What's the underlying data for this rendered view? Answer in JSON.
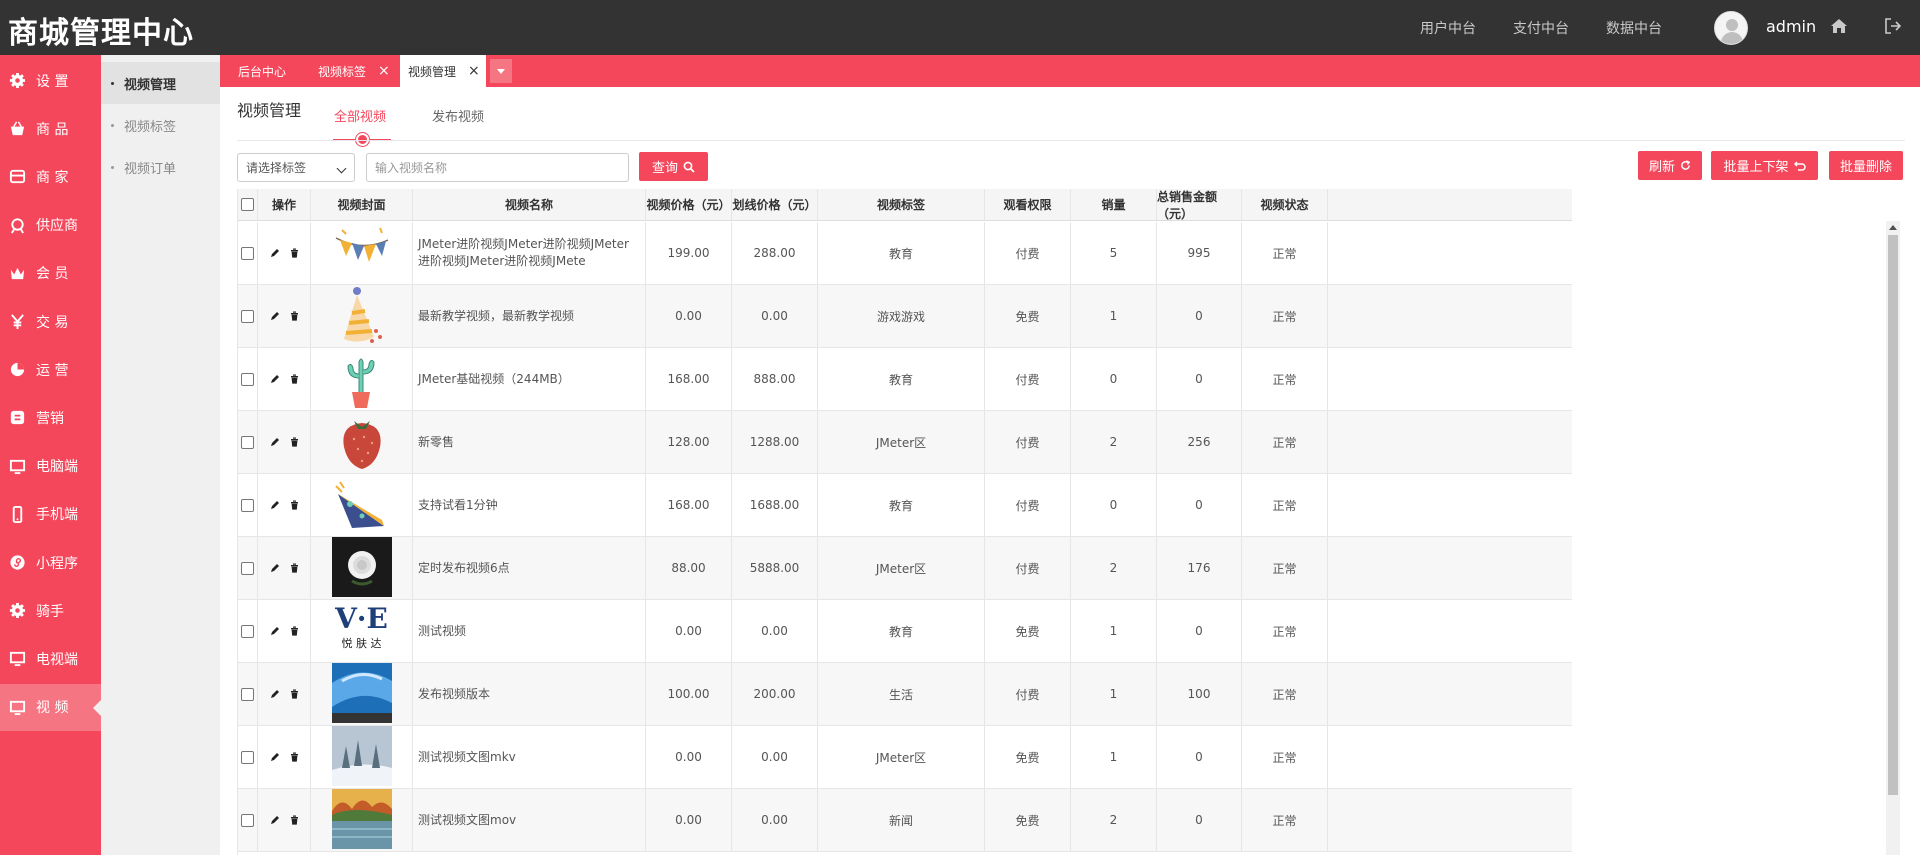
{
  "app": {
    "title": "商城管理中心",
    "user": "admin"
  },
  "topnav": [
    "用户中台",
    "支付中台",
    "数据中台"
  ],
  "sidebar": [
    {
      "label": "设 置",
      "icon": "gear-icon"
    },
    {
      "label": "商 品",
      "icon": "basket-icon"
    },
    {
      "label": "商 家",
      "icon": "store-icon"
    },
    {
      "label": "供应商",
      "icon": "supplier-icon"
    },
    {
      "label": "会 员",
      "icon": "crown-icon"
    },
    {
      "label": "交 易",
      "icon": "yen-icon"
    },
    {
      "label": "运 营",
      "icon": "pie-icon"
    },
    {
      "label": "营销",
      "icon": "marketing-icon"
    },
    {
      "label": "电脑端",
      "icon": "monitor-icon"
    },
    {
      "label": "手机端",
      "icon": "phone-icon"
    },
    {
      "label": "小程序",
      "icon": "miniapp-icon"
    },
    {
      "label": "骑手",
      "icon": "gear-icon"
    },
    {
      "label": "电视端",
      "icon": "monitor-icon"
    },
    {
      "label": "视 频",
      "icon": "monitor-icon",
      "active": true
    }
  ],
  "subnav": [
    {
      "label": "视频管理",
      "active": true
    },
    {
      "label": "视频标签"
    },
    {
      "label": "视频订单"
    }
  ],
  "tabs": [
    {
      "label": "后台中心",
      "closable": false
    },
    {
      "label": "视频标签",
      "closable": true,
      "close": "×"
    },
    {
      "label": "视频管理",
      "closable": true,
      "close": "×",
      "active": true
    }
  ],
  "page": {
    "title": "视频管理",
    "subtabs": [
      {
        "label": "全部视频",
        "active": true
      },
      {
        "label": "发布视频"
      }
    ]
  },
  "filters": {
    "tag_select": "请选择标签",
    "search_placeholder": "输入视频名称",
    "query_label": "查询"
  },
  "actions": {
    "refresh": "刷新",
    "batch_shelf": "批量上下架",
    "batch_delete": "批量删除"
  },
  "table": {
    "headers": [
      "操作",
      "视频封面",
      "视频名称",
      "视频价格（元）",
      "划线价格（元）",
      "视频标签",
      "观看权限",
      "销量",
      "总销售金额（元）",
      "视频状态"
    ],
    "rows": [
      {
        "cover": "bunting",
        "name": "JMeter进阶视频JMeter进阶视频JMeter进阶视频JMeter进阶视频JMete",
        "price": "199.00",
        "orig": "288.00",
        "tag": "教育",
        "perm": "付费",
        "sales": "5",
        "total": "995",
        "status": "正常"
      },
      {
        "cover": "party-hat",
        "name": "最新教学视频，最新教学视频",
        "price": "0.00",
        "orig": "0.00",
        "tag": "游戏游戏",
        "perm": "免费",
        "sales": "1",
        "total": "0",
        "status": "正常"
      },
      {
        "cover": "cactus",
        "name": "JMeter基础视频（244MB）",
        "price": "168.00",
        "orig": "888.00",
        "tag": "教育",
        "perm": "付费",
        "sales": "0",
        "total": "0",
        "status": "正常"
      },
      {
        "cover": "strawberry",
        "name": "新零售",
        "price": "128.00",
        "orig": "1288.00",
        "tag": "JMeter区",
        "perm": "付费",
        "sales": "2",
        "total": "256",
        "status": "正常"
      },
      {
        "cover": "cone-hat",
        "name": "支持试看1分钟",
        "price": "168.00",
        "orig": "1688.00",
        "tag": "教育",
        "perm": "付费",
        "sales": "0",
        "total": "0",
        "status": "正常"
      },
      {
        "cover": "flower",
        "name": "定时发布视频6点",
        "price": "88.00",
        "orig": "5888.00",
        "tag": "JMeter区",
        "perm": "付费",
        "sales": "2",
        "total": "176",
        "status": "正常"
      },
      {
        "cover": "logo-ve",
        "logo_text": "V·E",
        "logo_sub": "悦 肤 达",
        "name": "测试视频",
        "price": "0.00",
        "orig": "0.00",
        "tag": "教育",
        "perm": "免费",
        "sales": "1",
        "total": "0",
        "status": "正常"
      },
      {
        "cover": "blue-screen",
        "name": "发布视频版本",
        "price": "100.00",
        "orig": "200.00",
        "tag": "生活",
        "perm": "付费",
        "sales": "1",
        "total": "100",
        "status": "正常"
      },
      {
        "cover": "snow-forest",
        "name": "测试视频文图mkv",
        "price": "0.00",
        "orig": "0.00",
        "tag": "JMeter区",
        "perm": "免费",
        "sales": "1",
        "total": "0",
        "status": "正常"
      },
      {
        "cover": "autumn-lake",
        "name": "测试视频文图mov",
        "price": "0.00",
        "orig": "0.00",
        "tag": "新闻",
        "perm": "免费",
        "sales": "2",
        "total": "0",
        "status": "正常"
      }
    ]
  },
  "colors": {
    "brand": "#f5475c",
    "topbar": "#333333",
    "sidebar_active": "#f57583"
  }
}
